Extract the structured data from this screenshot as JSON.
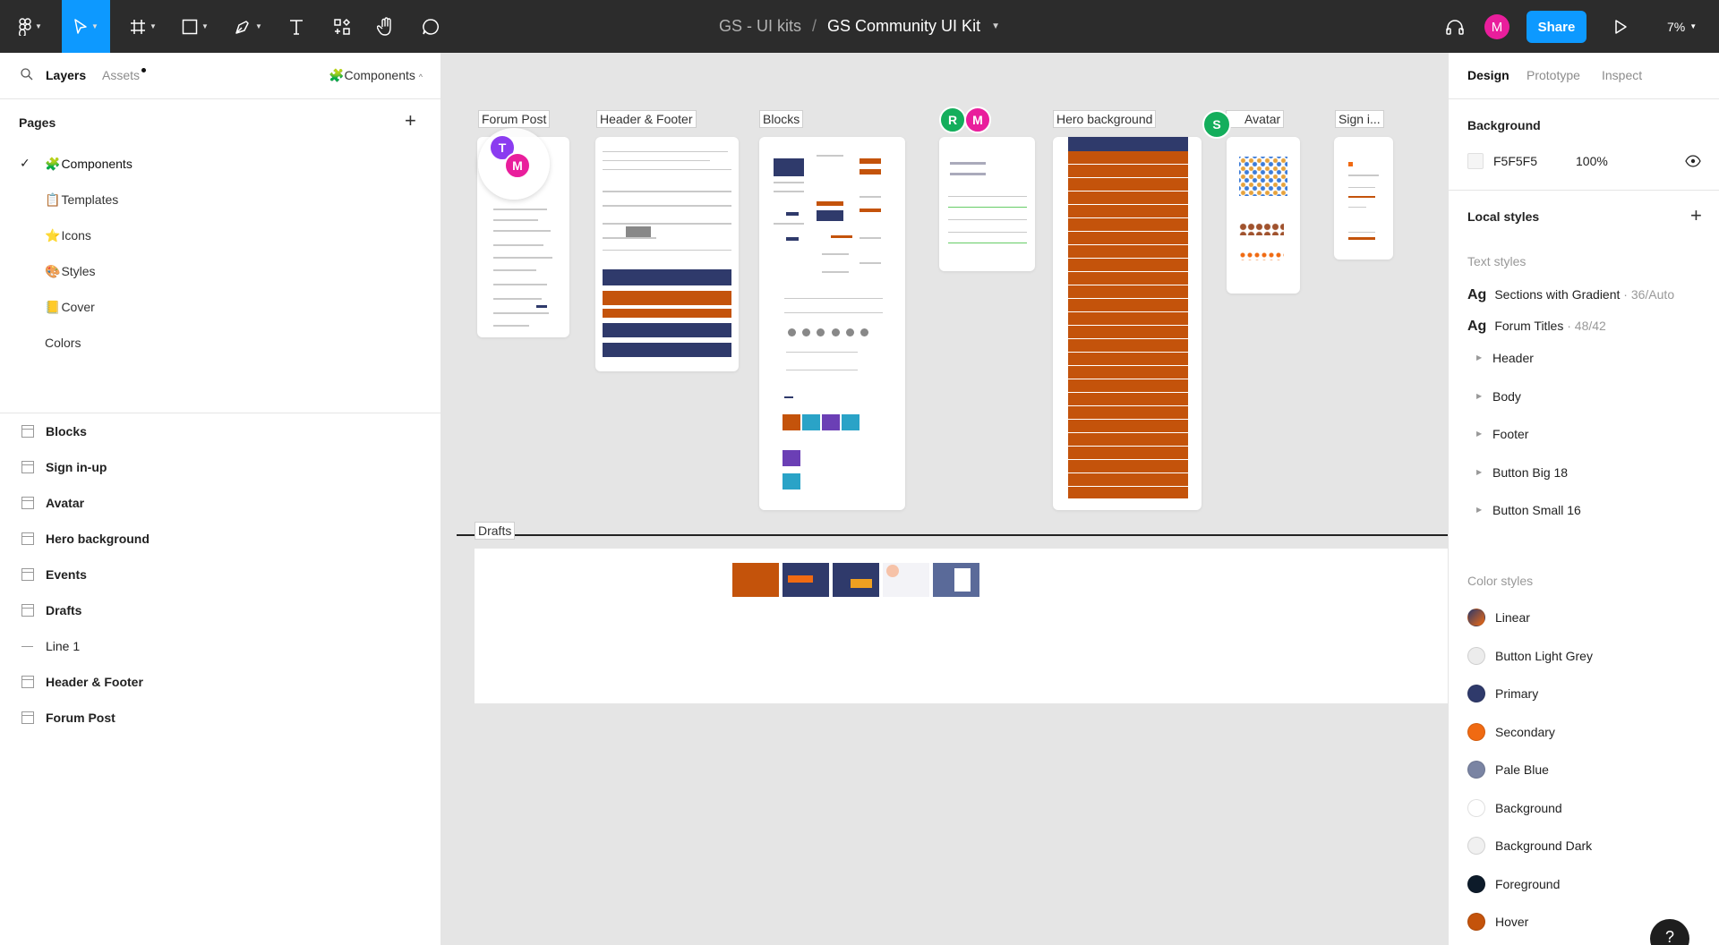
{
  "toolbar": {
    "project": "GS - UI kits",
    "separator": "/",
    "file": "GS Community UI Kit",
    "share": "Share",
    "user_initial": "M",
    "zoom": "7%"
  },
  "left_panel": {
    "tabs": {
      "layers": "Layers",
      "assets": "Assets"
    },
    "page_picker": "Components",
    "pages_title": "Pages",
    "pages": [
      {
        "emoji": "🧩",
        "label": "Components",
        "selected": true
      },
      {
        "emoji": "📋",
        "label": "Templates"
      },
      {
        "emoji": "⭐",
        "label": "Icons"
      },
      {
        "emoji": "🎨",
        "label": "Styles"
      },
      {
        "emoji": "📒",
        "label": "Cover"
      },
      {
        "emoji": "",
        "label": "Colors"
      }
    ],
    "layers": [
      {
        "label": "Blocks",
        "type": "frame"
      },
      {
        "label": "Sign in-up",
        "type": "frame"
      },
      {
        "label": "Avatar",
        "type": "frame"
      },
      {
        "label": "Hero background",
        "type": "frame"
      },
      {
        "label": "Events",
        "type": "frame"
      },
      {
        "label": "Drafts",
        "type": "frame"
      },
      {
        "label": "Line 1",
        "type": "line"
      },
      {
        "label": "Header & Footer",
        "type": "frame"
      },
      {
        "label": "Forum Post",
        "type": "frame"
      }
    ]
  },
  "canvas": {
    "frames": {
      "forum_post": "Forum Post",
      "header_footer": "Header & Footer",
      "blocks": "Blocks",
      "hero_background": "Hero background",
      "avatar": "Avatar",
      "sign_in": "Sign i..."
    },
    "drafts_label": "Drafts",
    "collaborators": {
      "t": "T",
      "m": "M",
      "r": "R",
      "m2": "M",
      "s": "S"
    },
    "colors": {
      "primary": "#2f3a6b",
      "secondary": "#c4530b"
    }
  },
  "right_panel": {
    "tabs": {
      "design": "Design",
      "prototype": "Prototype",
      "inspect": "Inspect"
    },
    "background_title": "Background",
    "background_hex": "F5F5F5",
    "background_opacity": "100%",
    "local_styles_title": "Local styles",
    "text_styles_title": "Text styles",
    "text_styles": [
      {
        "ag": "Ag",
        "name": "Sections with Gradient",
        "meta": " · 36/Auto"
      },
      {
        "ag": "Ag",
        "name": "Forum Titles",
        "meta": " · 48/42"
      }
    ],
    "text_groups": [
      "Header",
      "Body",
      "Footer",
      "Button Big 18",
      "Button Small 16"
    ],
    "color_styles_title": "Color styles",
    "color_styles": [
      {
        "name": "Linear",
        "color": "linear-gradient(135deg,#2f3a6b,#f06a12)"
      },
      {
        "name": "Button Light Grey",
        "color": "#ececec"
      },
      {
        "name": "Primary",
        "color": "#2f3a6b"
      },
      {
        "name": "Secondary",
        "color": "#f06a12"
      },
      {
        "name": "Pale Blue",
        "color": "#7a84a3"
      },
      {
        "name": "Background",
        "color": "#ffffff"
      },
      {
        "name": "Background Dark",
        "color": "#f0f0f0"
      },
      {
        "name": "Foreground",
        "color": "#0d1b2a"
      },
      {
        "name": "Hover",
        "color": "#c4530b"
      }
    ],
    "help": "?"
  }
}
